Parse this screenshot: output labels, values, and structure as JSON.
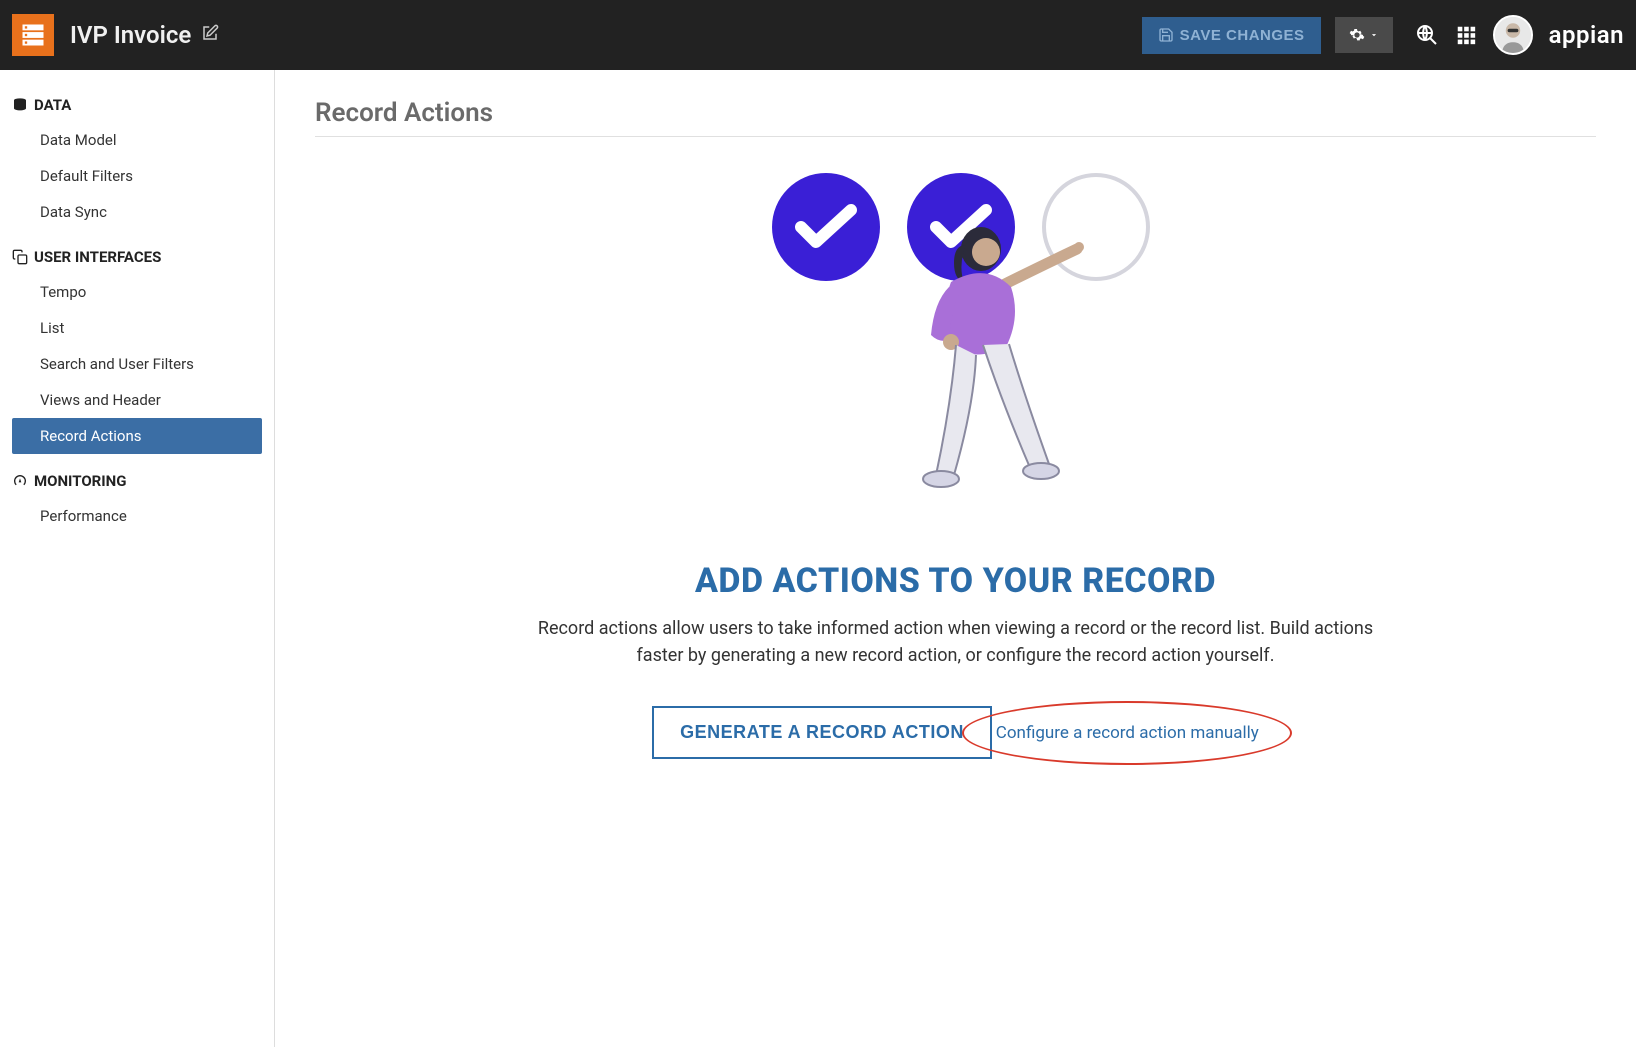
{
  "header": {
    "title": "IVP Invoice",
    "save_label": "SAVE CHANGES",
    "brand": "appian"
  },
  "sidebar": {
    "sections": [
      {
        "header": "DATA",
        "items": [
          "Data Model",
          "Default Filters",
          "Data Sync"
        ]
      },
      {
        "header": "USER INTERFACES",
        "items": [
          "Tempo",
          "List",
          "Search and User Filters",
          "Views and Header",
          "Record Actions"
        ]
      },
      {
        "header": "MONITORING",
        "items": [
          "Performance"
        ]
      }
    ]
  },
  "page": {
    "title": "Record Actions",
    "hero_heading": "ADD ACTIONS TO YOUR RECORD",
    "hero_text": "Record actions allow users to take informed action when viewing a record or the record list. Build actions faster by generating a new record action, or configure the record action yourself.",
    "primary_button": "GENERATE A RECORD ACTION",
    "manual_link": "Configure a record action manually"
  }
}
